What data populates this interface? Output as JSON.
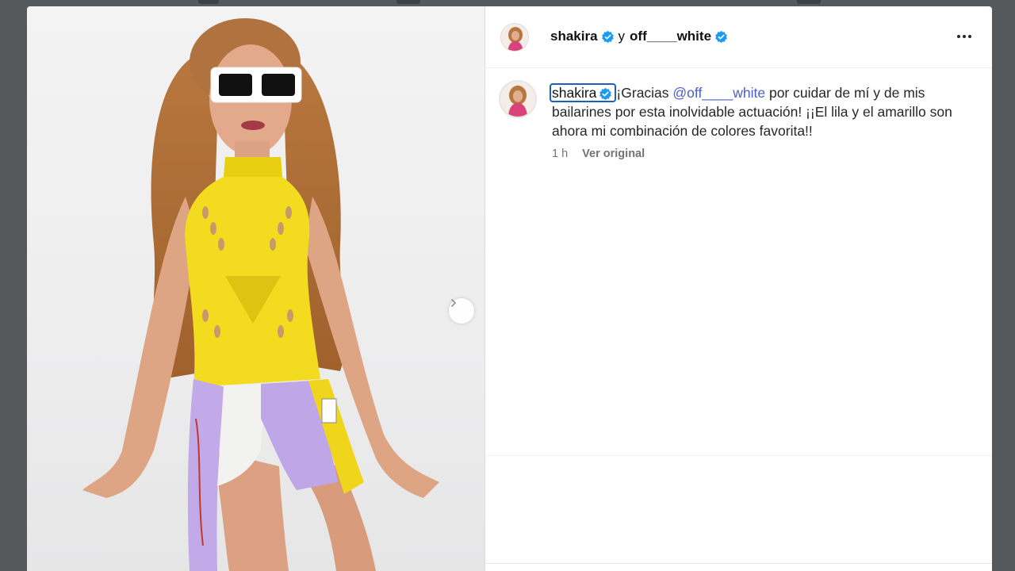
{
  "post": {
    "author": "shakira",
    "joiner": "y",
    "collaborator": "off____white",
    "caption": {
      "author": "shakira",
      "lead": "¡Gracias ",
      "mention": "@off____white",
      "rest": " por cuidar de mí y de mis bailarines por esta inolvidable actuación! ¡¡El lila y el amarillo son ahora mi combinación de colores favorita!!"
    },
    "timestamp": "1 h",
    "see_original": "Ver original"
  },
  "icons": {
    "verified": "verified-badge-icon",
    "more": "more-options-icon",
    "next": "chevron-right-icon"
  },
  "colors": {
    "verified": "#1d9bf0",
    "mention": "#4b5fc5",
    "focus_ring": "#1f5fbf",
    "backdrop": "#56595c"
  }
}
